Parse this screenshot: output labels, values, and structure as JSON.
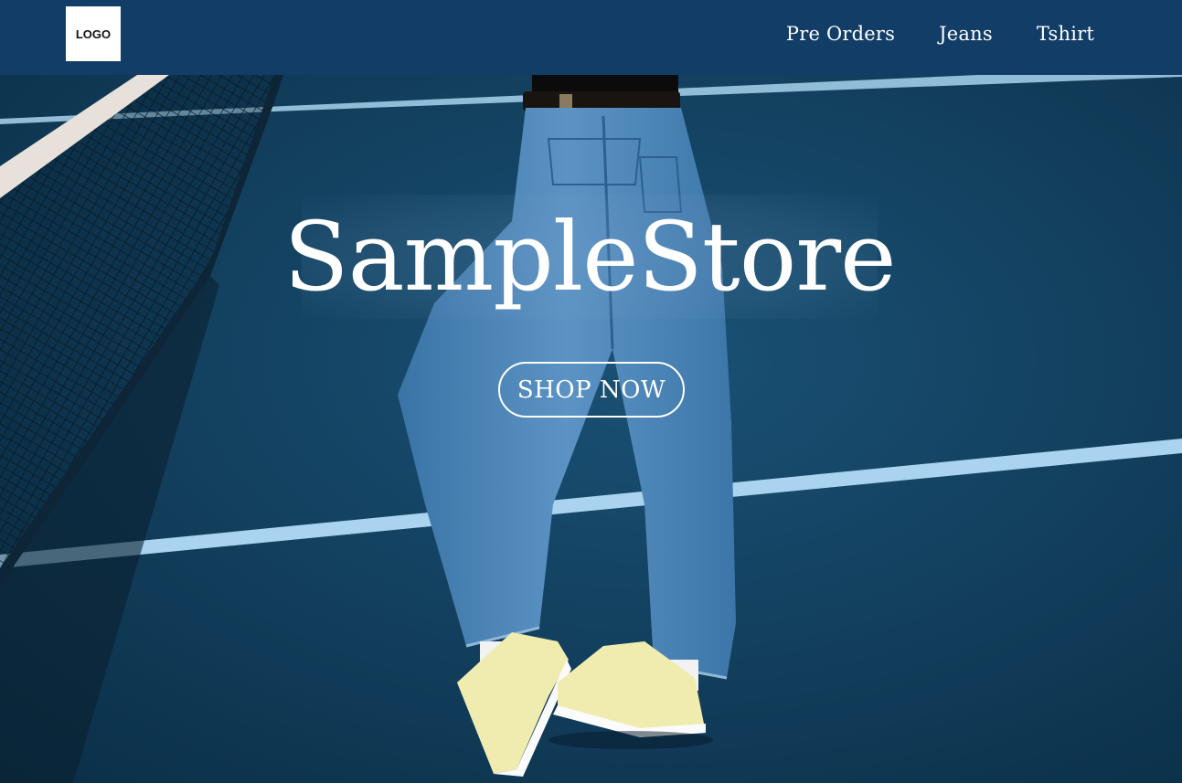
{
  "header": {
    "logo_text": "LOGO",
    "nav": [
      "Pre Orders",
      "Jeans",
      "Tshirt"
    ]
  },
  "hero": {
    "title": "SampleStore",
    "cta": "SHOP NOW"
  },
  "colors": {
    "header_bg": "#123d67",
    "court": "#0f3a5a",
    "court_lines": "#a9d3ee",
    "denim": "#4c86b8",
    "sneakers": "#f0ecb0",
    "text": "#ffffff"
  }
}
